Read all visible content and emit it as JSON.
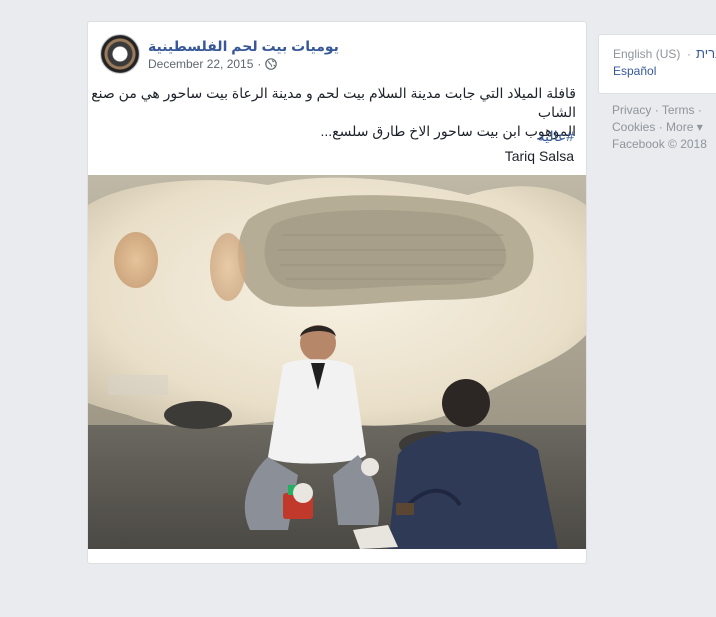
{
  "post": {
    "page_name": "يوميات بيت لحم الفلسطينية",
    "date": "December 22, 2015",
    "meta_separator": "·",
    "privacy_icon": "globe-icon",
    "text_line1": "قافلة الميلاد التي جابت مدينة السلام بيت لحم و مدينة الرعاة بيت ساحور هي من صنع الشاب",
    "text_line2": "الموهوب ابن بيت ساحور الاخ طارق سلسع...",
    "hashtag": "#عالية",
    "tagged_name": "Tariq Salsa"
  },
  "sidebar": {
    "lang_current": "English (US)",
    "lang_separator": "·",
    "lang_hebrew": "עברית",
    "lang_espanol": "Español"
  },
  "footer": {
    "privacy": "Privacy",
    "terms": "Terms",
    "cookies": "Cookies",
    "more": "More",
    "sep": "·",
    "more_arrow": "▾",
    "copyright": "Facebook © 2018"
  },
  "colors": {
    "link": "#365899",
    "muted": "#90949c",
    "background": "#e9ebee"
  }
}
